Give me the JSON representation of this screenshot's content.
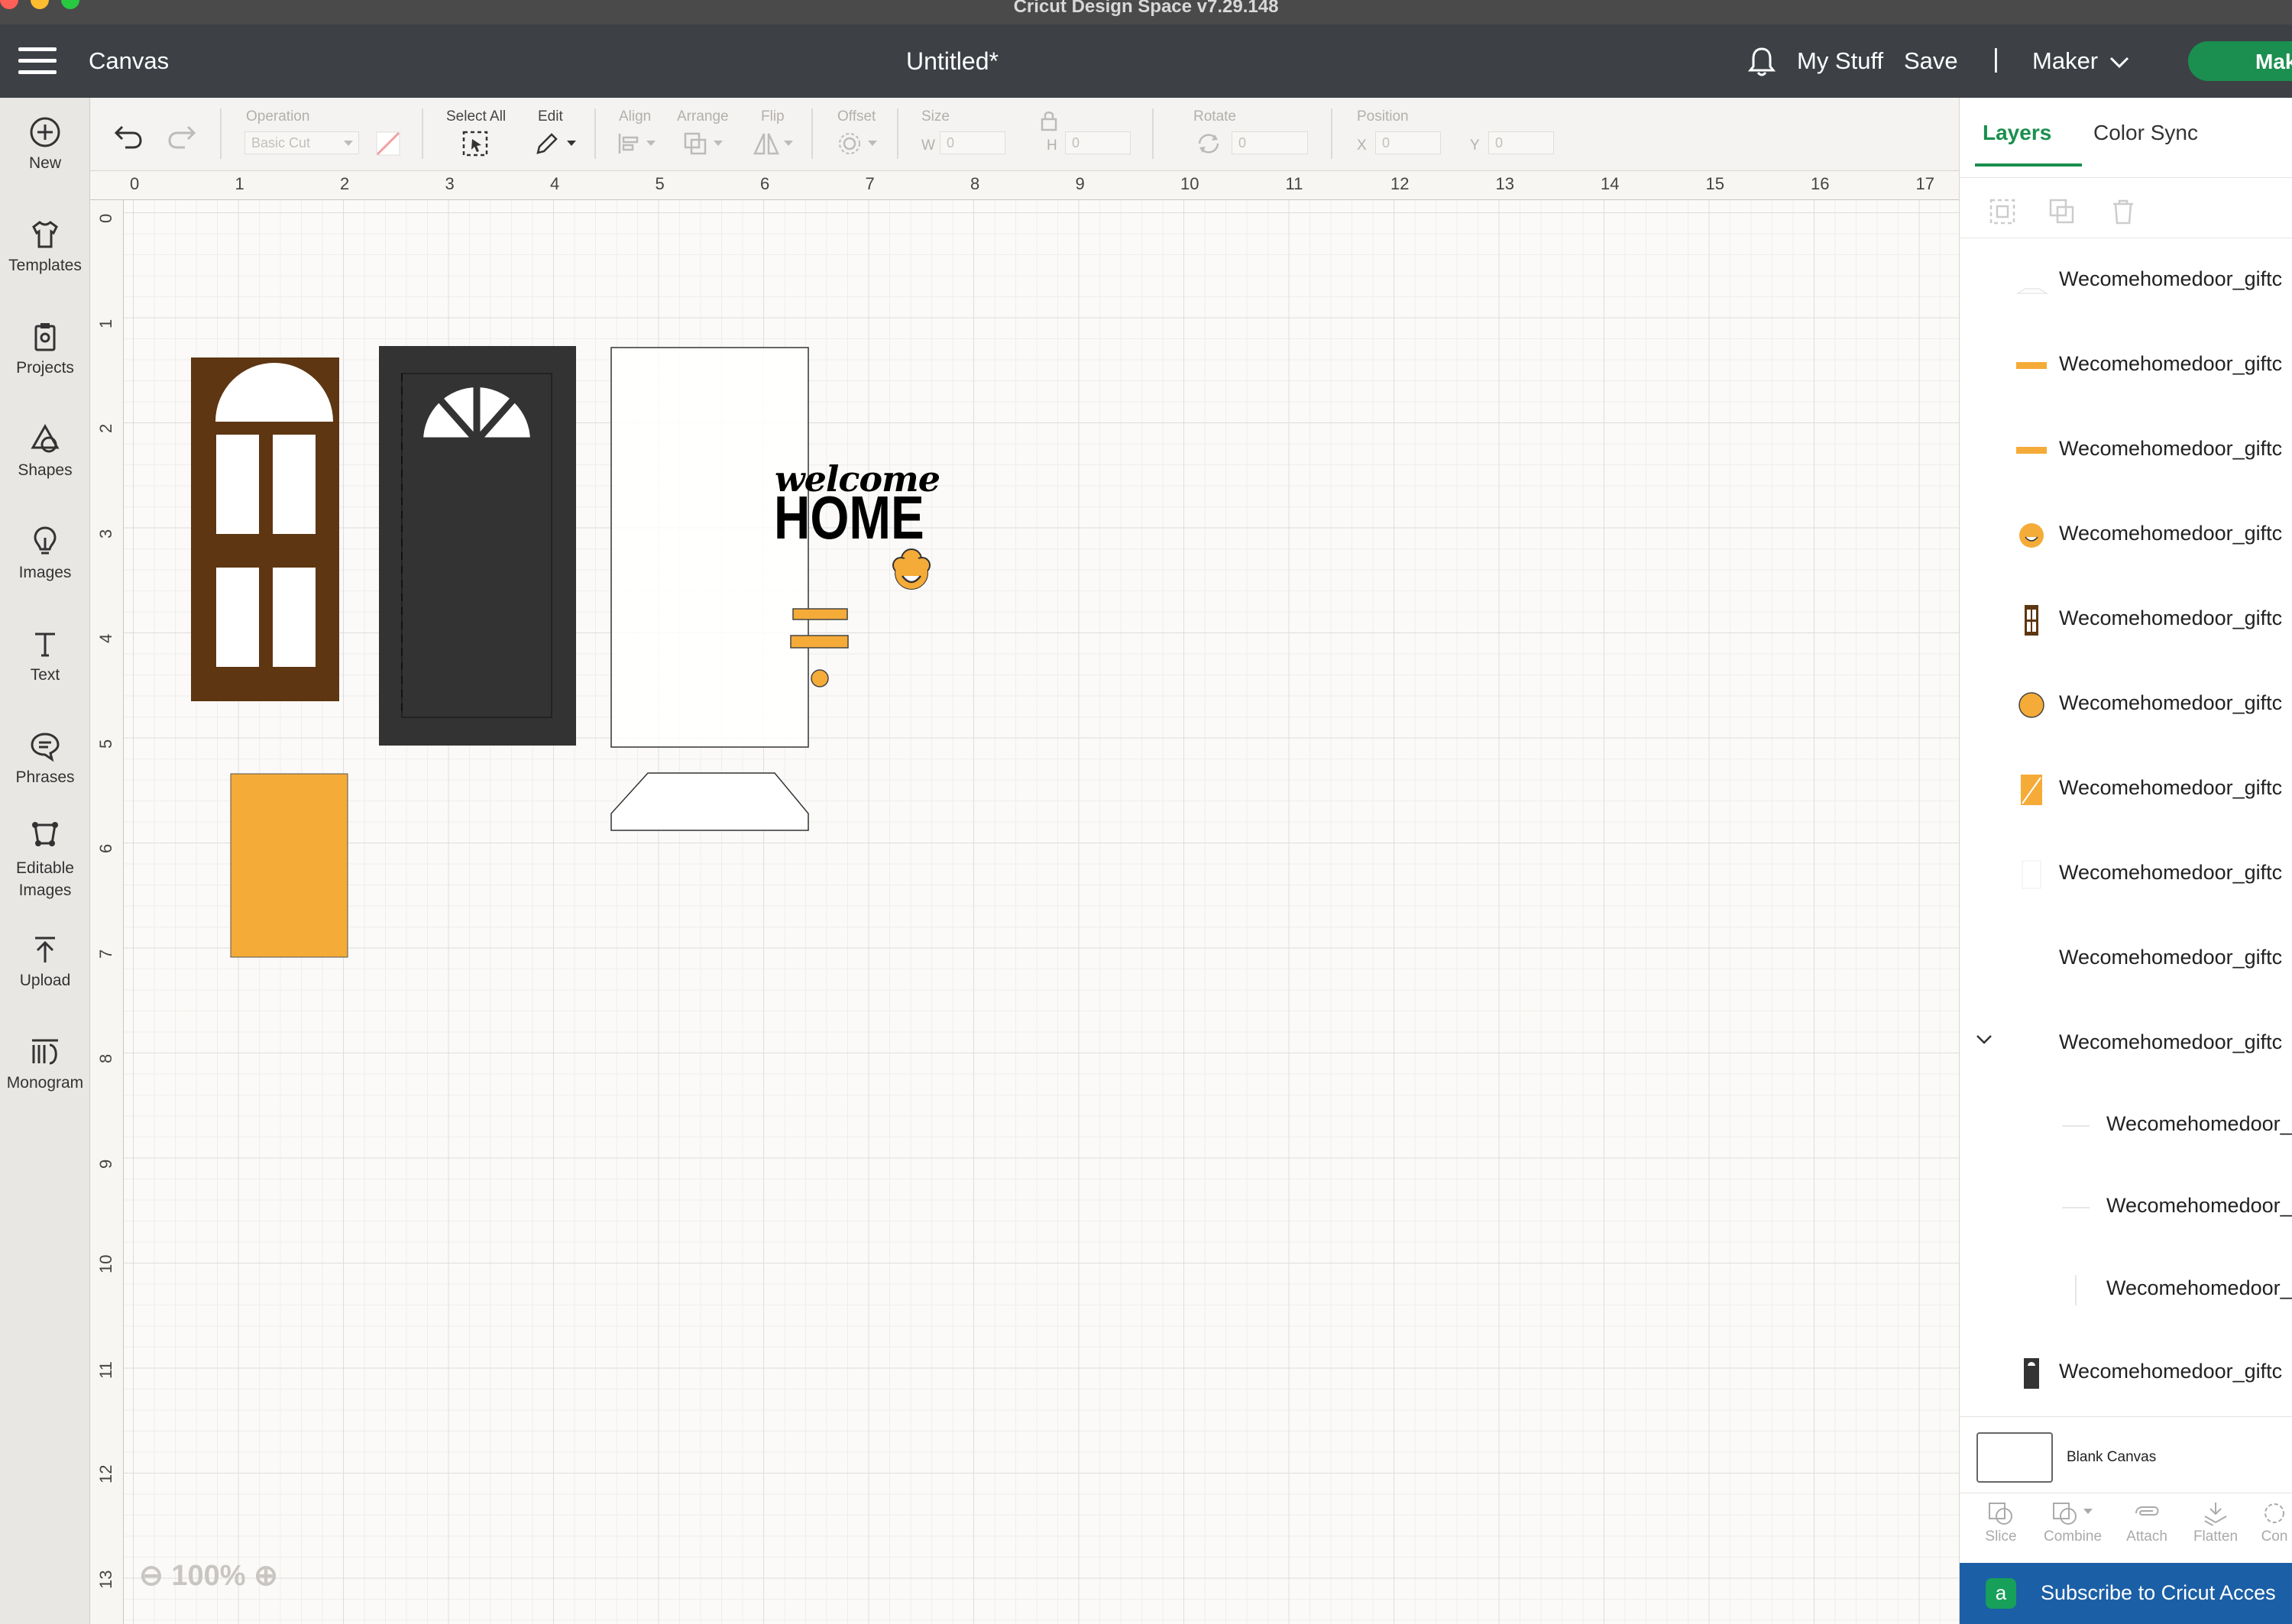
{
  "window": {
    "title": "Cricut Design Space  v7.29.148"
  },
  "header": {
    "menu_icon": "hamburger-menu-icon",
    "section": "Canvas",
    "doc_title": "Untitled*",
    "my_stuff": "My Stuff",
    "save": "Save",
    "divider": "|",
    "machine": "Maker",
    "make_button": "Make"
  },
  "sidebar": {
    "items": [
      {
        "label": "New",
        "icon": "plus-circle-icon"
      },
      {
        "label": "Templates",
        "icon": "shirt-icon"
      },
      {
        "label": "Projects",
        "icon": "clipboard-icon"
      },
      {
        "label": "Shapes",
        "icon": "shapes-icon"
      },
      {
        "label": "Images",
        "icon": "lightbulb-icon"
      },
      {
        "label": "Text",
        "icon": "text-t-icon"
      },
      {
        "label": "Phrases",
        "icon": "speech-bubble-icon"
      },
      {
        "label": "Editable Images",
        "icon": "editable-image-icon"
      },
      {
        "label": "Upload",
        "icon": "upload-icon"
      },
      {
        "label": "Monogram",
        "icon": "monogram-icon"
      }
    ]
  },
  "toolbar": {
    "operation_label": "Operation",
    "operation_value": "Basic Cut",
    "select_all": "Select All",
    "edit": "Edit",
    "align": "Align",
    "arrange": "Arrange",
    "flip": "Flip",
    "offset": "Offset",
    "size": "Size",
    "size_w": "W",
    "size_h": "H",
    "size_w_value": "0",
    "size_h_value": "0",
    "rotate": "Rotate",
    "rotate_value": "0",
    "position": "Position",
    "pos_x": "X",
    "pos_y": "Y",
    "pos_x_value": "0",
    "pos_y_value": "0"
  },
  "ruler": {
    "top": [
      "0",
      "1",
      "2",
      "3",
      "4",
      "5",
      "6",
      "7",
      "8",
      "9",
      "10",
      "11",
      "12",
      "13",
      "14",
      "15",
      "16",
      "17"
    ],
    "left": [
      "0",
      "1",
      "2",
      "3",
      "4",
      "5",
      "6",
      "7",
      "8",
      "9",
      "10",
      "11",
      "12",
      "13"
    ]
  },
  "canvas": {
    "welcome_text": "welcome",
    "home_text": "HOME",
    "zoom": "100%",
    "colors": {
      "brown": "#5e3612",
      "dark": "#333333",
      "orange": "#f5ab38",
      "white": "#ffffff"
    }
  },
  "panel": {
    "tab_layers": "Layers",
    "tab_color_sync": "Color Sync",
    "layers": [
      {
        "name": "Wecomehomedoor_giftc",
        "thumb": "white-shape"
      },
      {
        "name": "Wecomehomedoor_giftc",
        "thumb": "orange-bar"
      },
      {
        "name": "Wecomehomedoor_giftc",
        "thumb": "orange-bar"
      },
      {
        "name": "Wecomehomedoor_giftc",
        "thumb": "orange-wreath"
      },
      {
        "name": "Wecomehomedoor_giftc",
        "thumb": "brown-door"
      },
      {
        "name": "Wecomehomedoor_giftc",
        "thumb": "orange-circle"
      },
      {
        "name": "Wecomehomedoor_giftc",
        "thumb": "orange-rect"
      },
      {
        "name": "Wecomehomedoor_giftc",
        "thumb": "white-rect"
      },
      {
        "name": "Wecomehomedoor_giftc",
        "thumb": "blank"
      },
      {
        "name": "Wecomehomedoor_giftc",
        "thumb": "group-expanded"
      },
      {
        "name": "Wecomehomedoor_",
        "thumb": "line"
      },
      {
        "name": "Wecomehomedoor_",
        "thumb": "line"
      },
      {
        "name": "Wecomehomedoor_",
        "thumb": "vertical-line"
      },
      {
        "name": "Wecomehomedoor_giftc",
        "thumb": "dark-door"
      }
    ],
    "blank_canvas": "Blank Canvas",
    "bottom_tools": [
      "Slice",
      "Combine",
      "Attach",
      "Flatten",
      "Con"
    ],
    "subscribe": "Subscribe to Cricut Acces",
    "subscribe_icon": "a"
  }
}
